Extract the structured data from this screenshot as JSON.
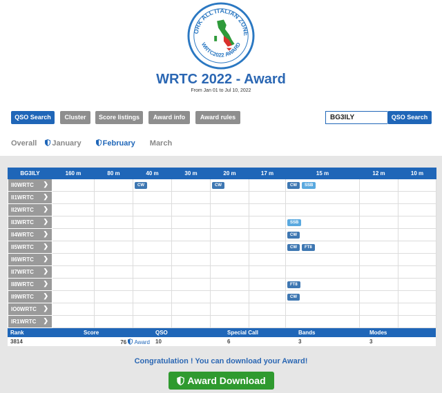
{
  "logo": {
    "arc_text": "WORK ALL ITALIAN ZONES",
    "bottom_text": "WRTC2022 AWARD"
  },
  "page": {
    "title": "WRTC 2022 - Award",
    "subtitle": "From Jan 01 to Jul 10, 2022"
  },
  "toolbar": {
    "buttons": [
      "QSO Search",
      "Cluster",
      "Score listings",
      "Award info",
      "Award rules"
    ],
    "callsign_value": "BG3ILY",
    "search_button": "QSO Search"
  },
  "months": [
    "Overall",
    "January",
    "February",
    "March"
  ],
  "grid": {
    "callsign": "BG3ILY",
    "bands": [
      "160 m",
      "80 m",
      "40 m",
      "30 m",
      "20 m",
      "17 m",
      "15 m",
      "12 m",
      "10 m"
    ],
    "rows": [
      {
        "call": "II0WRTC",
        "cells": [
          [],
          [],
          [
            "CW"
          ],
          [],
          [
            "CW"
          ],
          [],
          [
            "CW",
            "SSB"
          ],
          [],
          []
        ]
      },
      {
        "call": "II1WRTC",
        "cells": [
          [],
          [],
          [],
          [],
          [],
          [],
          [],
          [],
          []
        ]
      },
      {
        "call": "II2WRTC",
        "cells": [
          [],
          [],
          [],
          [],
          [],
          [],
          [],
          [],
          []
        ]
      },
      {
        "call": "II3WRTC",
        "cells": [
          [],
          [],
          [],
          [],
          [],
          [],
          [
            "SSB"
          ],
          [],
          []
        ]
      },
      {
        "call": "II4WRTC",
        "cells": [
          [],
          [],
          [],
          [],
          [],
          [],
          [
            "CW"
          ],
          [],
          []
        ]
      },
      {
        "call": "II5WRTC",
        "cells": [
          [],
          [],
          [],
          [],
          [],
          [],
          [
            "CW",
            "FT8"
          ],
          [],
          []
        ]
      },
      {
        "call": "II6WRTC",
        "cells": [
          [],
          [],
          [],
          [],
          [],
          [],
          [],
          [],
          []
        ]
      },
      {
        "call": "II7WRTC",
        "cells": [
          [],
          [],
          [],
          [],
          [],
          [],
          [],
          [],
          []
        ]
      },
      {
        "call": "II8WRTC",
        "cells": [
          [],
          [],
          [],
          [],
          [],
          [],
          [
            "FT8"
          ],
          [],
          []
        ]
      },
      {
        "call": "II9WRTC",
        "cells": [
          [],
          [],
          [],
          [],
          [],
          [],
          [
            "CW"
          ],
          [],
          []
        ]
      },
      {
        "call": "IO0WRTC",
        "cells": [
          [],
          [],
          [],
          [],
          [],
          [],
          [],
          [],
          []
        ]
      },
      {
        "call": "IR1WRTC",
        "cells": [
          [],
          [],
          [],
          [],
          [],
          [],
          [],
          [],
          []
        ]
      }
    ]
  },
  "stats": {
    "headers": [
      "Rank",
      "Score",
      "QSO",
      "Special Call",
      "Bands",
      "Modes"
    ],
    "rank": "3814",
    "score": "76",
    "score_link": "Award",
    "qso": "10",
    "special_call": "6",
    "bands": "3",
    "modes": "3"
  },
  "congrats": "Congratulation ! You can download your Award!",
  "download_label": "Award Download",
  "colors": {
    "primary": "#1f66b8",
    "grey_button": "#8e8e8e",
    "download_green": "#2f9a2f",
    "mode_chip": "#3e77b2",
    "ssb_chip": "#5aa9df"
  }
}
